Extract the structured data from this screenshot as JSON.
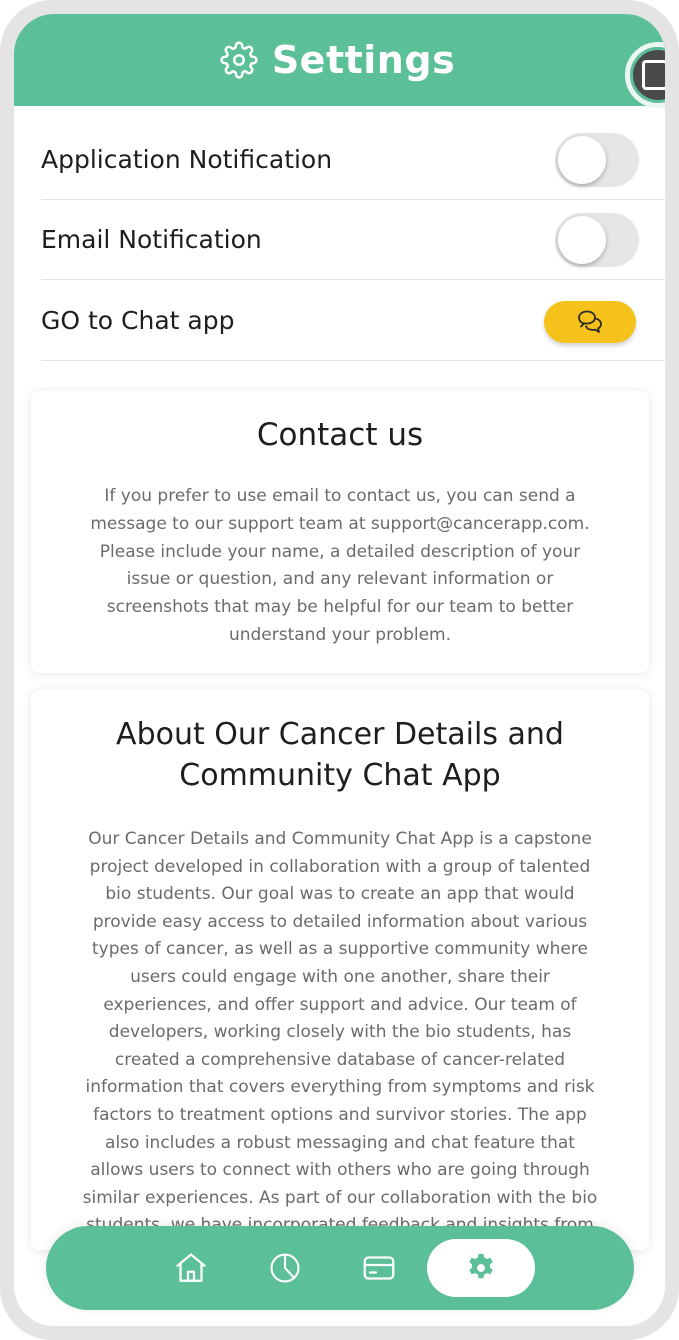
{
  "header": {
    "title": "Settings",
    "icon": "gear-icon",
    "corner_icon": "edit-icon"
  },
  "settings": {
    "app_notification": {
      "label": "Application Notification",
      "enabled": false
    },
    "email_notification": {
      "label": "Email Notification",
      "enabled": false
    },
    "chat_app": {
      "label": "GO to Chat app",
      "icon": "chat-bubble-icon"
    }
  },
  "contact": {
    "title": "Contact us",
    "lines": [
      "If you prefer to use email to contact us, you can send a",
      "message to our support team at support@cancerapp.com.",
      "Please include your name, a detailed description of your",
      "issue or question, and any relevant information or",
      "screenshots that may be helpful for our team to better",
      "understand your problem."
    ]
  },
  "about": {
    "title_lines": [
      "About Our Cancer Details and",
      "Community Chat App"
    ],
    "lines": [
      "Our Cancer Details and Community Chat App is a capstone",
      "project developed in collaboration with a group of talented",
      "bio students. Our goal was to create an app that would",
      "provide easy access to detailed information about various",
      "types of cancer, as well as a supportive community where",
      "users could engage with one another, share their",
      "experiences, and offer support and advice. Our team of",
      "developers, working closely with the bio students, has",
      "created a comprehensive database of cancer-related",
      "information that covers everything from symptoms and risk",
      "factors to treatment options and survivor stories. The app",
      "also includes a robust messaging and chat feature that",
      "allows users to connect with others who are going through",
      "similar experiences. As part of our collaboration with the bio",
      "students, we have incorporated feedback and insights from"
    ]
  },
  "nav": {
    "items": [
      {
        "icon": "home-icon"
      },
      {
        "icon": "pie-chart-icon"
      },
      {
        "icon": "card-icon"
      },
      {
        "icon": "gear-icon",
        "active": true
      }
    ]
  },
  "colors": {
    "accent": "#5bbf98",
    "chat_button": "#f5c21b",
    "text_dark": "#1e1e1e",
    "text_muted": "#6b6b6b"
  }
}
